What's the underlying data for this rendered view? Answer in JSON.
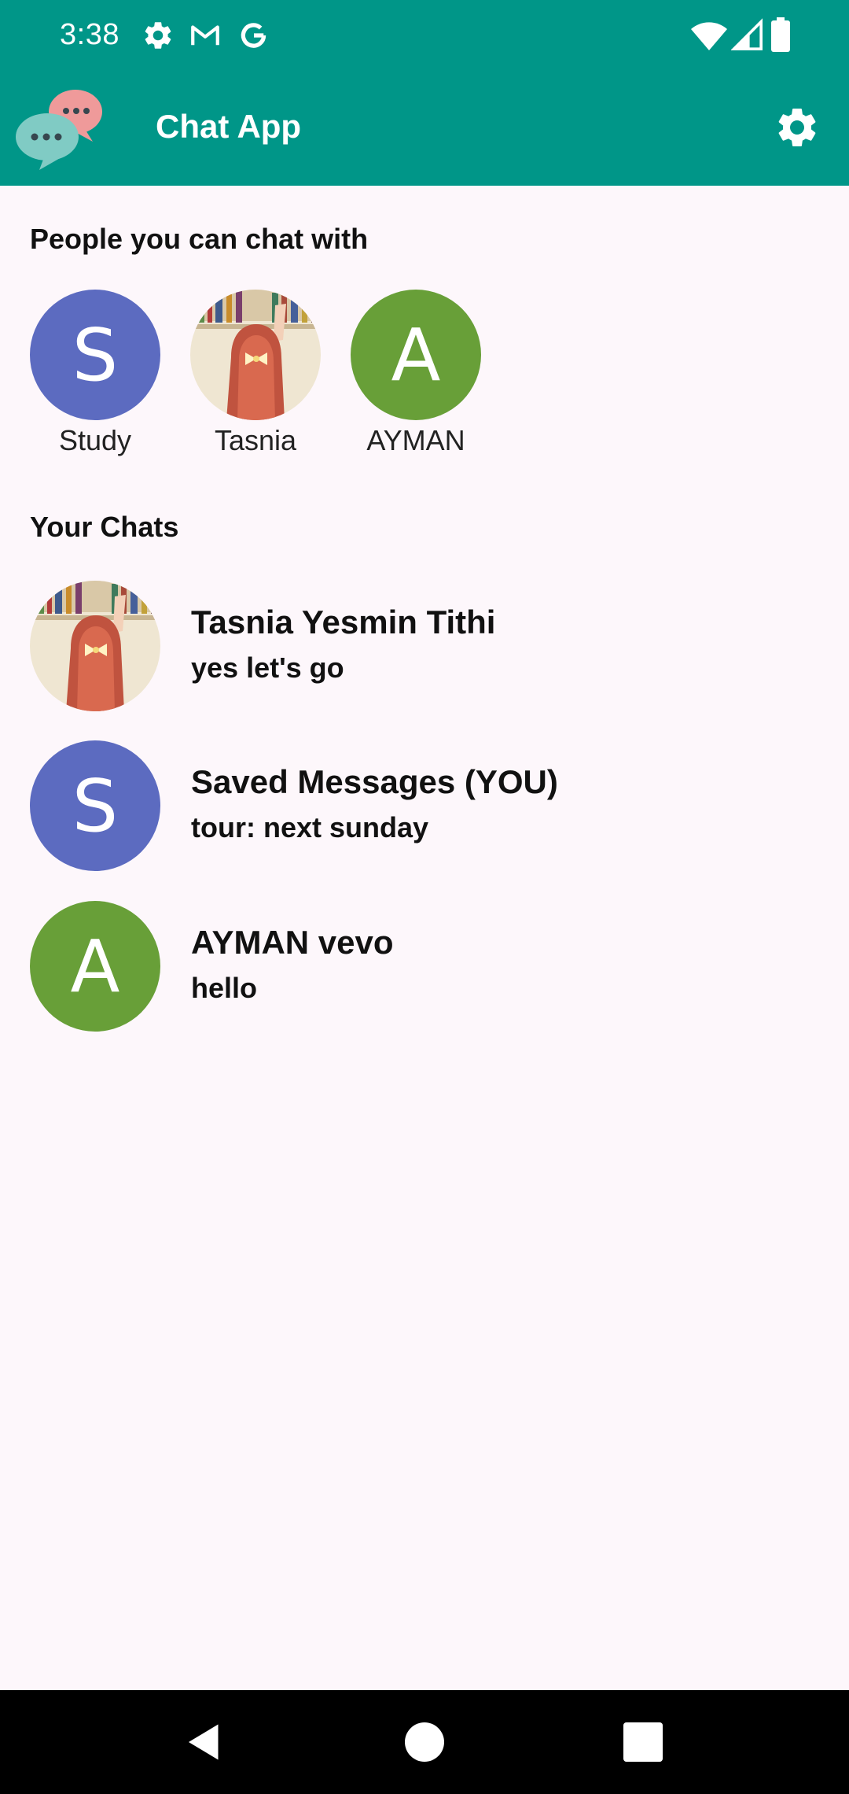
{
  "status_bar": {
    "time": "3:38",
    "left_icons": [
      "gear-icon",
      "gmail-icon",
      "google-icon"
    ],
    "right_icons": [
      "wifi-icon",
      "signal-icon",
      "battery-icon"
    ]
  },
  "app_bar": {
    "title": "Chat App",
    "logo_icon": "chat-bubbles-logo",
    "settings_icon": "gear-icon",
    "background_color": "#009688"
  },
  "people_section": {
    "title": "People you can chat with",
    "people": [
      {
        "name": "Study",
        "avatar_letter": "S",
        "avatar_color": "#5c6bc0",
        "avatar_type": "letter"
      },
      {
        "name": "Tasnia",
        "avatar_letter": "",
        "avatar_color": "#e8d9c2",
        "avatar_type": "photo"
      },
      {
        "name": "AYMAN",
        "avatar_letter": "A",
        "avatar_color": "#689f38",
        "avatar_type": "letter"
      }
    ]
  },
  "chats_section": {
    "title": "Your Chats",
    "chats": [
      {
        "name": "Tasnia Yesmin Tithi",
        "preview": "yes let's go",
        "avatar_letter": "",
        "avatar_color": "#e8d9c2",
        "avatar_type": "photo"
      },
      {
        "name": "Saved Messages (YOU)",
        "preview": "tour: next sunday",
        "avatar_letter": "S",
        "avatar_color": "#5c6bc0",
        "avatar_type": "letter"
      },
      {
        "name": "AYMAN vevo",
        "preview": "hello",
        "avatar_letter": "A",
        "avatar_color": "#689f38",
        "avatar_type": "letter"
      }
    ]
  },
  "nav_bar": {
    "buttons": [
      "back-icon",
      "home-icon",
      "recents-icon"
    ]
  }
}
